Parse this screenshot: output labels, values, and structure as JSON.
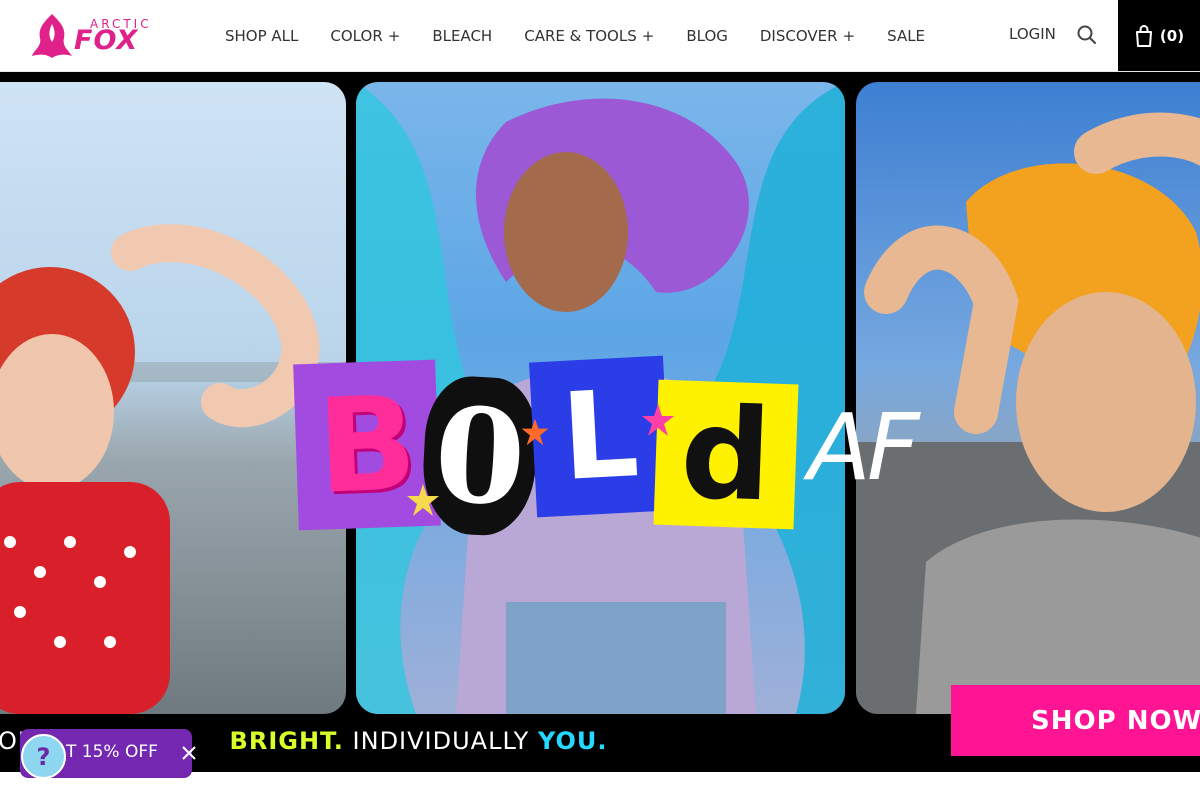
{
  "header": {
    "logo": {
      "top_text": "ARCTIC",
      "main_text": "FOX"
    },
    "nav": [
      {
        "label": "SHOP ALL",
        "has_plus": false
      },
      {
        "label": "COLOR",
        "has_plus": true
      },
      {
        "label": "BLEACH",
        "has_plus": false
      },
      {
        "label": "CARE & TOOLS",
        "has_plus": true
      },
      {
        "label": "BLOG",
        "has_plus": false
      },
      {
        "label": "DISCOVER",
        "has_plus": true
      },
      {
        "label": "SALE",
        "has_plus": false
      }
    ],
    "plus_symbol": "+",
    "login_label": "LOGIN",
    "search_icon": "search-icon",
    "cart_icon": "shopping-bag-icon",
    "cart_count": "(0)"
  },
  "hero": {
    "letters": [
      "B",
      "0",
      "L",
      "d"
    ],
    "af_text": "AF",
    "tagline_prefix": "OL",
    "tagline_bright": "BRIGHT.",
    "tagline_middle": "INDIVIDUALLY",
    "tagline_you": "YOU.",
    "cta_label": "SHOP NOW"
  },
  "promo": {
    "text": "T 15% OFF",
    "close_icon": "close-icon"
  },
  "help": {
    "label": "?",
    "icon": "help-icon"
  },
  "colors": {
    "brand_pink": "#e0218a",
    "cta_pink": "#ff1493",
    "promo_purple": "#7428b0",
    "help_blue": "#8fd6f0",
    "bright_yellow": "#d7ff2a",
    "you_cyan": "#24d8ff"
  }
}
